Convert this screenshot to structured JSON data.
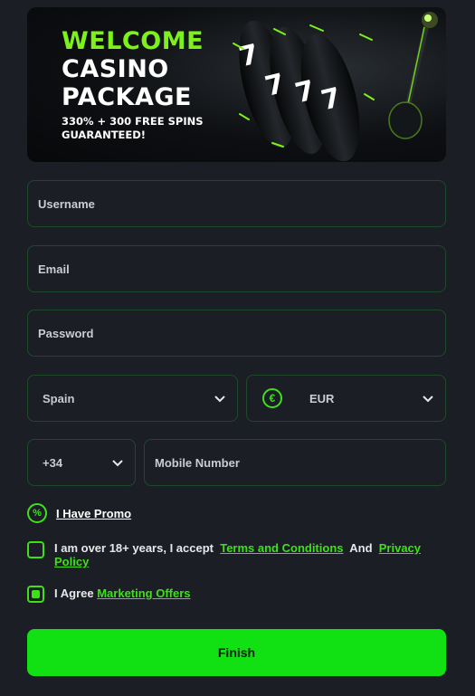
{
  "banner": {
    "line1": "WELCOME",
    "line2": "CASINO",
    "line3": "PACKAGE",
    "sub1": "330% + 300 FREE SPINS",
    "sub2": "GUARANTEED!"
  },
  "form": {
    "username_placeholder": "Username",
    "email_placeholder": "Email",
    "password_placeholder": "Password",
    "country_value": "Spain",
    "currency_value": "EUR",
    "currency_symbol": "€",
    "phone_code_value": "+34",
    "mobile_placeholder": "Mobile Number"
  },
  "promo": {
    "icon_glyph": "%",
    "label": "I Have Promo"
  },
  "terms": {
    "prefix": "I am over 18+ years, I accept",
    "link1": "Terms and Conditions",
    "and": "And",
    "link2": "Privacy Policy",
    "checked": false
  },
  "marketing": {
    "prefix": "I Agree",
    "link": "Marketing Offers",
    "checked": true
  },
  "finish_label": "Finish",
  "colors": {
    "accent": "#3fe01a",
    "button": "#11e112",
    "background": "#1b1e25",
    "field_border": "#1f4a2a"
  }
}
